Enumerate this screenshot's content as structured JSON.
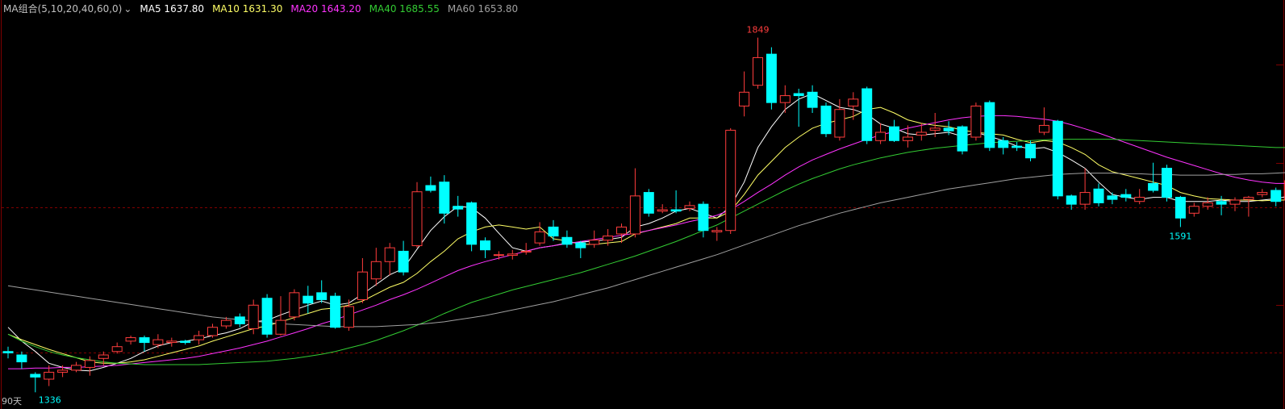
{
  "legend": {
    "indicator": "MA组合(5,10,20,40,60,0)",
    "dropdown_glyph": "⌄",
    "ma5": "MA5 1637.80",
    "ma10": "MA10 1631.30",
    "ma20": "MA20 1643.20",
    "ma40": "MA40 1685.55",
    "ma60": "MA60 1653.80"
  },
  "period_label": "90天",
  "annotations": {
    "high": "1849",
    "low_left": "1336",
    "low_right": "1591"
  },
  "colors": {
    "up": "#ff3d3d",
    "down": "#00ffff",
    "ma5": "#ffffff",
    "ma10": "#ffff66",
    "ma20": "#ff33ff",
    "ma40": "#33cc33",
    "ma60": "#a0a0a0",
    "grid": "#800000"
  },
  "chart_data": {
    "type": "candlestick",
    "ylim": [
      1320,
      1880
    ],
    "candles": [
      [
        1395,
        1393,
        1402,
        1385
      ],
      [
        1390,
        1380,
        1395,
        1370
      ],
      [
        1362,
        1358,
        1365,
        1336
      ],
      [
        1355,
        1365,
        1375,
        1345
      ],
      [
        1365,
        1368,
        1375,
        1358
      ],
      [
        1368,
        1375,
        1380,
        1365
      ],
      [
        1372,
        1382,
        1388,
        1360
      ],
      [
        1385,
        1390,
        1395,
        1375
      ],
      [
        1395,
        1402,
        1408,
        1392
      ],
      [
        1410,
        1415,
        1418,
        1405
      ],
      [
        1415,
        1408,
        1418,
        1395
      ],
      [
        1405,
        1412,
        1420,
        1400
      ],
      [
        1408,
        1410,
        1415,
        1402
      ],
      [
        1410,
        1408,
        1412,
        1405
      ],
      [
        1412,
        1418,
        1425,
        1405
      ],
      [
        1418,
        1430,
        1435,
        1415
      ],
      [
        1432,
        1440,
        1445,
        1428
      ],
      [
        1445,
        1435,
        1450,
        1430
      ],
      [
        1428,
        1462,
        1470,
        1420
      ],
      [
        1472,
        1420,
        1478,
        1415
      ],
      [
        1420,
        1440,
        1475,
        1418
      ],
      [
        1445,
        1480,
        1485,
        1440
      ],
      [
        1475,
        1465,
        1490,
        1450
      ],
      [
        1480,
        1470,
        1498,
        1465
      ],
      [
        1475,
        1430,
        1480,
        1428
      ],
      [
        1430,
        1460,
        1470,
        1425
      ],
      [
        1470,
        1510,
        1530,
        1465
      ],
      [
        1500,
        1525,
        1545,
        1490
      ],
      [
        1525,
        1545,
        1552,
        1505
      ],
      [
        1540,
        1510,
        1555,
        1505
      ],
      [
        1548,
        1626,
        1640,
        1545
      ],
      [
        1635,
        1628,
        1648,
        1625
      ],
      [
        1640,
        1595,
        1650,
        1580
      ],
      [
        1605,
        1601,
        1620,
        1590
      ],
      [
        1610,
        1550,
        1612,
        1540
      ],
      [
        1555,
        1542,
        1560,
        1530
      ],
      [
        1534,
        1535,
        1540,
        1528
      ],
      [
        1534,
        1536,
        1542,
        1528
      ],
      [
        1540,
        1540,
        1552,
        1535
      ],
      [
        1552,
        1568,
        1582,
        1548
      ],
      [
        1575,
        1562,
        1585,
        1555
      ],
      [
        1560,
        1550,
        1570,
        1545
      ],
      [
        1552,
        1545,
        1555,
        1530
      ],
      [
        1550,
        1556,
        1570,
        1545
      ],
      [
        1556,
        1562,
        1572,
        1548
      ],
      [
        1565,
        1575,
        1580,
        1552
      ],
      [
        1565,
        1620,
        1660,
        1560
      ],
      [
        1625,
        1595,
        1630,
        1590
      ],
      [
        1598,
        1600,
        1608,
        1595
      ],
      [
        1600,
        1598,
        1628,
        1595
      ],
      [
        1602,
        1606,
        1612,
        1598
      ],
      [
        1608,
        1570,
        1612,
        1560
      ],
      [
        1568,
        1570,
        1575,
        1555
      ],
      [
        1570,
        1715,
        1718,
        1565
      ],
      [
        1750,
        1770,
        1800,
        1735
      ],
      [
        1780,
        1820,
        1849,
        1775
      ],
      [
        1825,
        1755,
        1835,
        1745
      ],
      [
        1755,
        1765,
        1780,
        1740
      ],
      [
        1768,
        1765,
        1775,
        1720
      ],
      [
        1770,
        1748,
        1780,
        1740
      ],
      [
        1750,
        1710,
        1755,
        1705
      ],
      [
        1705,
        1745,
        1760,
        1700
      ],
      [
        1750,
        1760,
        1770,
        1730
      ],
      [
        1775,
        1700,
        1778,
        1695
      ],
      [
        1700,
        1712,
        1725,
        1695
      ],
      [
        1720,
        1700,
        1730,
        1698
      ],
      [
        1700,
        1705,
        1722,
        1690
      ],
      [
        1708,
        1712,
        1725,
        1700
      ],
      [
        1715,
        1718,
        1740,
        1705
      ],
      [
        1718,
        1714,
        1728,
        1708
      ],
      [
        1720,
        1685,
        1722,
        1680
      ],
      [
        1705,
        1750,
        1755,
        1700
      ],
      [
        1755,
        1690,
        1758,
        1685
      ],
      [
        1700,
        1690,
        1705,
        1680
      ],
      [
        1692,
        1690,
        1698,
        1685
      ],
      [
        1695,
        1675,
        1700,
        1670
      ],
      [
        1712,
        1722,
        1748,
        1708
      ],
      [
        1728,
        1620,
        1730,
        1615
      ],
      [
        1620,
        1608,
        1622,
        1600
      ],
      [
        1608,
        1625,
        1660,
        1600
      ],
      [
        1630,
        1610,
        1638,
        1605
      ],
      [
        1620,
        1615,
        1625,
        1608
      ],
      [
        1622,
        1618,
        1630,
        1612
      ],
      [
        1612,
        1618,
        1630,
        1608
      ],
      [
        1638,
        1628,
        1668,
        1625
      ],
      [
        1660,
        1618,
        1665,
        1612
      ],
      [
        1618,
        1588,
        1620,
        1575
      ],
      [
        1595,
        1605,
        1610,
        1590
      ],
      [
        1605,
        1610,
        1618,
        1600
      ],
      [
        1612,
        1608,
        1620,
        1592
      ],
      [
        1608,
        1614,
        1618,
        1598
      ],
      [
        1615,
        1618,
        1620,
        1590
      ],
      [
        1622,
        1625,
        1630,
        1618
      ],
      [
        1628,
        1612,
        1632,
        1605
      ],
      [
        1614,
        1642,
        1648,
        1612
      ]
    ],
    "series": [
      {
        "name": "MA5",
        "values": [
          1430,
          1410,
          1395,
          1378,
          1372,
          1368,
          1367,
          1372,
          1378,
          1385,
          1395,
          1403,
          1408,
          1410,
          1413,
          1418,
          1422,
          1428,
          1438,
          1440,
          1448,
          1455,
          1462,
          1468,
          1462,
          1465,
          1478,
          1492,
          1506,
          1515,
          1543,
          1570,
          1590,
          1605,
          1603,
          1588,
          1566,
          1545,
          1540,
          1545,
          1548,
          1552,
          1553,
          1555,
          1557,
          1560,
          1575,
          1580,
          1588,
          1598,
          1602,
          1595,
          1588,
          1605,
          1640,
          1690,
          1720,
          1745,
          1760,
          1768,
          1758,
          1748,
          1745,
          1738,
          1724,
          1718,
          1710,
          1708,
          1710,
          1712,
          1706,
          1712,
          1706,
          1700,
          1692,
          1688,
          1690,
          1683,
          1672,
          1660,
          1640,
          1622,
          1618,
          1615,
          1618,
          1618,
          1612,
          1612,
          1612,
          1614,
          1612,
          1612,
          1614,
          1616,
          1620
        ]
      },
      {
        "name": "MA10",
        "values": [
          1420,
          1412,
          1405,
          1398,
          1392,
          1386,
          1380,
          1378,
          1378,
          1380,
          1383,
          1388,
          1393,
          1398,
          1403,
          1410,
          1416,
          1422,
          1428,
          1432,
          1438,
          1444,
          1450,
          1456,
          1458,
          1462,
          1468,
          1478,
          1488,
          1495,
          1508,
          1525,
          1540,
          1558,
          1568,
          1575,
          1578,
          1575,
          1572,
          1575,
          1558,
          1555,
          1550,
          1550,
          1552,
          1554,
          1565,
          1570,
          1575,
          1580,
          1588,
          1588,
          1588,
          1598,
          1622,
          1650,
          1670,
          1690,
          1705,
          1718,
          1725,
          1730,
          1735,
          1745,
          1748,
          1740,
          1730,
          1725,
          1722,
          1720,
          1715,
          1712,
          1710,
          1708,
          1702,
          1697,
          1700,
          1698,
          1690,
          1680,
          1665,
          1655,
          1650,
          1645,
          1640,
          1635,
          1625,
          1620,
          1616,
          1615,
          1614,
          1614,
          1613,
          1614,
          1614
        ]
      },
      {
        "name": "MA20",
        "values": [
          1370,
          1370,
          1371,
          1371,
          1372,
          1372,
          1373,
          1374,
          1375,
          1377,
          1379,
          1381,
          1383,
          1385,
          1388,
          1392,
          1396,
          1400,
          1405,
          1410,
          1416,
          1422,
          1428,
          1435,
          1441,
          1448,
          1455,
          1462,
          1470,
          1477,
          1485,
          1494,
          1503,
          1512,
          1519,
          1525,
          1530,
          1535,
          1540,
          1545,
          1548,
          1551,
          1554,
          1557,
          1560,
          1563,
          1566,
          1570,
          1574,
          1578,
          1583,
          1587,
          1592,
          1600,
          1612,
          1625,
          1637,
          1650,
          1662,
          1672,
          1680,
          1688,
          1695,
          1702,
          1708,
          1713,
          1718,
          1722,
          1726,
          1730,
          1733,
          1735,
          1736,
          1736,
          1735,
          1733,
          1731,
          1728,
          1723,
          1717,
          1711,
          1704,
          1697,
          1690,
          1683,
          1676,
          1670,
          1664,
          1658,
          1652,
          1647,
          1643,
          1640,
          1638,
          1638
        ]
      },
      {
        "name": "MA40",
        "values": [
          1420,
          1410,
          1402,
          1395,
          1390,
          1386,
          1383,
          1380,
          1378,
          1377,
          1376,
          1376,
          1376,
          1376,
          1376,
          1377,
          1378,
          1379,
          1380,
          1381,
          1383,
          1385,
          1388,
          1391,
          1395,
          1400,
          1405,
          1411,
          1418,
          1425,
          1433,
          1441,
          1450,
          1458,
          1466,
          1472,
          1478,
          1484,
          1489,
          1494,
          1499,
          1504,
          1509,
          1515,
          1521,
          1527,
          1533,
          1540,
          1547,
          1554,
          1562,
          1570,
          1578,
          1588,
          1598,
          1608,
          1618,
          1628,
          1637,
          1645,
          1652,
          1659,
          1665,
          1670,
          1675,
          1679,
          1683,
          1686,
          1689,
          1691,
          1693,
          1695,
          1697,
          1698,
          1699,
          1700,
          1701,
          1702,
          1702,
          1702,
          1702,
          1702,
          1701,
          1700,
          1699,
          1698,
          1697,
          1696,
          1695,
          1694,
          1693,
          1692,
          1691,
          1690,
          1690
        ]
      },
      {
        "name": "MA60",
        "values": [
          1490,
          1487,
          1484,
          1481,
          1478,
          1475,
          1472,
          1469,
          1466,
          1463,
          1460,
          1457,
          1454,
          1451,
          1448,
          1445,
          1443,
          1441,
          1439,
          1437,
          1435,
          1434,
          1433,
          1432,
          1431,
          1431,
          1431,
          1431,
          1432,
          1433,
          1434,
          1436,
          1438,
          1441,
          1444,
          1447,
          1451,
          1455,
          1459,
          1463,
          1467,
          1472,
          1477,
          1482,
          1487,
          1493,
          1499,
          1505,
          1511,
          1517,
          1523,
          1529,
          1535,
          1542,
          1549,
          1556,
          1563,
          1570,
          1577,
          1583,
          1589,
          1595,
          1600,
          1605,
          1610,
          1614,
          1618,
          1622,
          1626,
          1630,
          1633,
          1636,
          1639,
          1642,
          1645,
          1647,
          1649,
          1651,
          1652,
          1653,
          1653,
          1653,
          1652,
          1652,
          1651,
          1651,
          1650,
          1650,
          1650,
          1651,
          1651,
          1652,
          1652,
          1653,
          1654
        ]
      }
    ]
  }
}
